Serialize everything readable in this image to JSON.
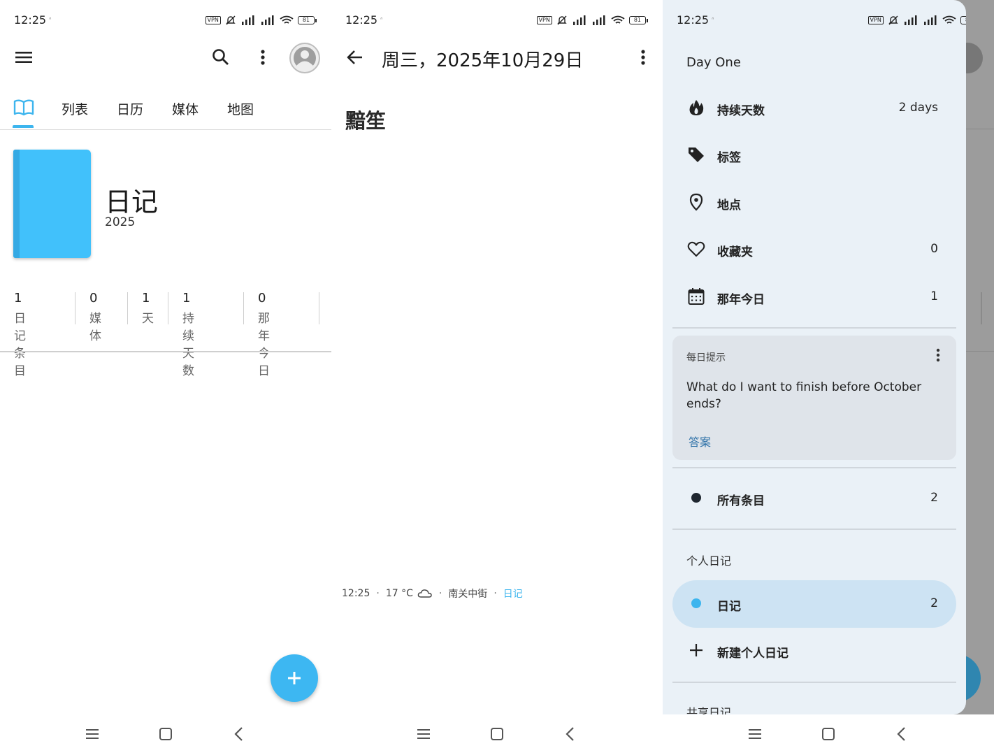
{
  "status_bar": {
    "time": "12:25",
    "vpn": "VPN",
    "battery": "81",
    "notif_glyph": "ᐢ"
  },
  "panel1": {
    "tabs": [
      "列表",
      "日历",
      "媒体",
      "地图"
    ],
    "journal_title": "日记",
    "journal_year": "2025",
    "cover_color": "#41c1fb",
    "stats": [
      {
        "value": "1",
        "label": "日记条目"
      },
      {
        "value": "0",
        "label": "媒体"
      },
      {
        "value": "1",
        "label": "天"
      },
      {
        "value": "1",
        "label": "持续天数"
      },
      {
        "value": "0",
        "label": "那年今日"
      }
    ],
    "fab_label": "+"
  },
  "panel2": {
    "date_title": "周三，2025年10月29日",
    "body_text": "黯笙",
    "meta": {
      "time": "12:25",
      "temp": "17 °C",
      "location": "南关中街",
      "journal": "日记"
    }
  },
  "panel3": {
    "app_name": "Day One",
    "items": [
      {
        "icon": "flame-icon",
        "label": "持续天数",
        "count": "2 days"
      },
      {
        "icon": "tag-icon",
        "label": "标签",
        "count": ""
      },
      {
        "icon": "location-pin-icon",
        "label": "地点",
        "count": ""
      },
      {
        "icon": "heart-icon",
        "label": "收藏夹",
        "count": "0"
      },
      {
        "icon": "calendar-icon",
        "label": "那年今日",
        "count": "1"
      }
    ],
    "tip": {
      "heading": "每日提示",
      "question": "What do I want to finish before October ends?",
      "answer": "答案"
    },
    "all_entries": {
      "label": "所有条目",
      "count": "2"
    },
    "personal_heading": "个人日记",
    "journal": {
      "label": "日记",
      "count": "2",
      "color": "#3db5ee"
    },
    "new_journal": "新建个人日记",
    "shared_heading": "共享日记"
  },
  "colors": {
    "accent": "#3db5ee",
    "drawer_bg": "#eaf1f7",
    "selected_bg": "#cde3f3"
  }
}
